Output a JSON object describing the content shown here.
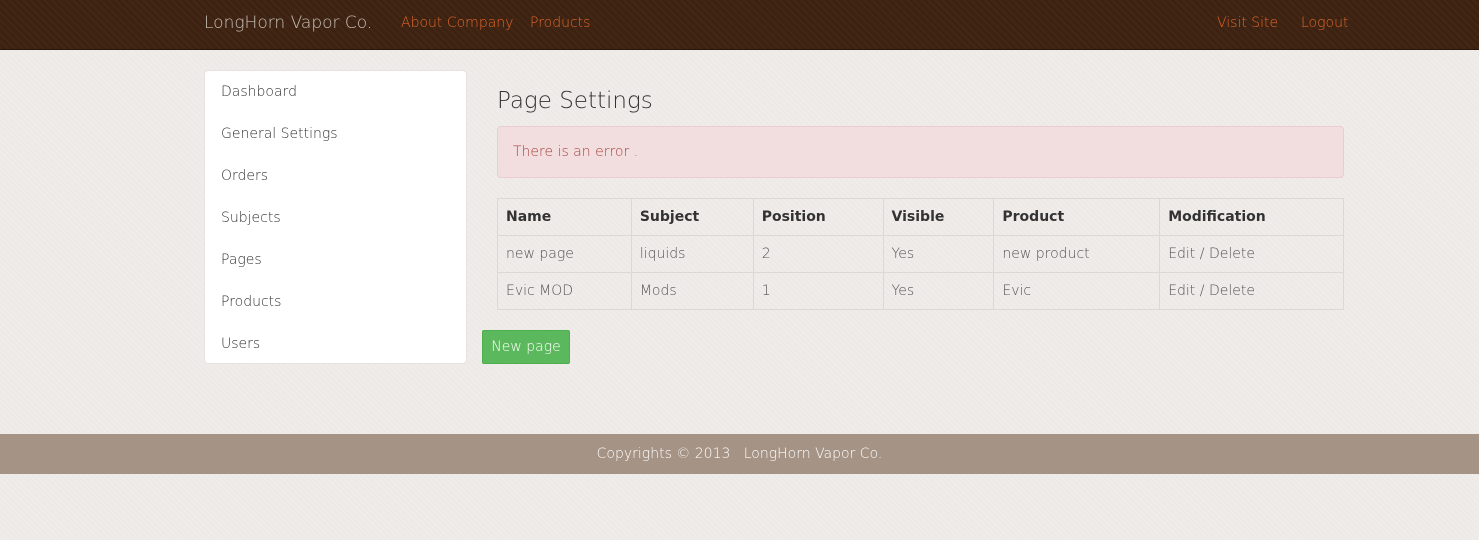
{
  "navbar": {
    "brand": "LongHorn Vapor Co.",
    "links_left": [
      "About Company",
      "Products"
    ],
    "links_right": [
      "Visit Site",
      "Logout"
    ],
    "link_color": "#e0662a"
  },
  "sidebar": {
    "items": [
      {
        "label": "Dashboard"
      },
      {
        "label": "General Settings"
      },
      {
        "label": "Orders"
      },
      {
        "label": "Subjects"
      },
      {
        "label": "Pages"
      },
      {
        "label": "Products"
      },
      {
        "label": "Users"
      }
    ]
  },
  "main": {
    "title": "Page Settings",
    "alert": "There is an error .",
    "table": {
      "headers": [
        "Name",
        "Subject",
        "Position",
        "Visible",
        "Product",
        "Modification"
      ],
      "rows": [
        {
          "name": "new page",
          "subject": "liquids",
          "position": "2",
          "visible": "Yes",
          "product": "new product",
          "edit": "Edit",
          "sep": "/",
          "delete": "Delete"
        },
        {
          "name": "Evic MOD",
          "subject": "Mods",
          "position": "1",
          "visible": "Yes",
          "product": "Evic",
          "edit": "Edit",
          "sep": "/",
          "delete": "Delete"
        }
      ]
    },
    "new_button": "New page"
  },
  "footer": {
    "copyright": "Copyrights © 2013",
    "company": "LongHorn Vapor Co."
  },
  "colors": {
    "navbar_bg": "#3d2211",
    "alert_bg": "#f2dede",
    "alert_text": "#a94442",
    "button_bg": "#5cb85c",
    "footer_bg": "#a59385"
  }
}
